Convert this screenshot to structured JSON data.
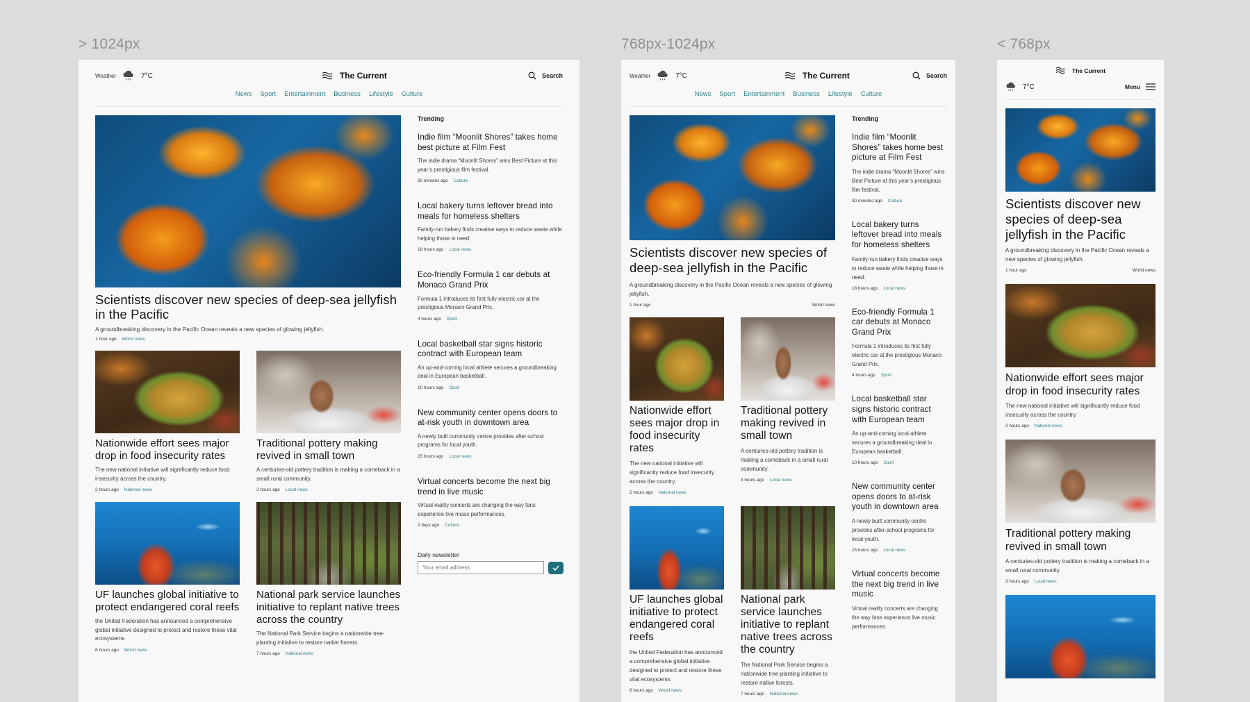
{
  "breakpoints": {
    "desktop": "> 1024px",
    "tablet": "768px-1024px",
    "mobile": "< 768px"
  },
  "header": {
    "weather_label": "Weather",
    "weather_icon": "rain-cloud-icon",
    "temperature": "7°C",
    "brand_icon": "waves-icon",
    "brand_name": "The Current",
    "search_label": "Search",
    "search_icon": "search-icon",
    "menu_label": "Menu",
    "menu_icon": "hamburger-icon"
  },
  "nav": [
    "News",
    "Sport",
    "Entertainment",
    "Business",
    "Lifestyle",
    "Culture"
  ],
  "hero": {
    "title": "Scientists discover new species of deep-sea jellyfish in the Pacific",
    "summary": "A groundbreaking discovery in the Pacific Ocean reveals a new species of glowing jellyfish.",
    "time": "1 hour ago",
    "category": "World news",
    "image": "jellyfish-photo"
  },
  "cards": [
    {
      "title": "Nationwide effort sees major drop in food insecurity rates",
      "summary": "The new national initiative will significantly reduce food insecurity across the country.",
      "time": "2 hours ago",
      "category": "National news",
      "image": "pasta-photo"
    },
    {
      "title": "Traditional pottery making revived in small town",
      "summary": "A centuries-old pottery tradition is making a comeback in a small rural community.",
      "time": "3 hours ago",
      "category": "Local news",
      "image": "pottery-photo"
    },
    {
      "title": "UF launches global initiative to protect endangered coral reefs",
      "summary": "the United Federation has announced a comprehensive global initiative designed to protect and restore these vital ecosystems",
      "time": "6 hours ago",
      "category": "World news",
      "image": "coral-reef-photo"
    },
    {
      "title": "National park service launches initiative to replant native trees across the country",
      "summary": "The National Park Service begins a nationwide tree-planting initiative to restore native forests.",
      "time": "7 hours ago",
      "category": "National news",
      "image": "forest-photo"
    }
  ],
  "trending": {
    "title": "Trending",
    "items": [
      {
        "title": "Indie film “Moonlit Shores” takes home best picture at Film Fest",
        "summary": "The indie drama “Moonlit Shores” wins Best Picture at this year’s prestigious film festival.",
        "time": "30 minutes ago",
        "category": "Culture"
      },
      {
        "title": "Local bakery turns leftover bread into meals for homeless shelters",
        "summary": "Family-run bakery finds creative ways to reduce waste while helping those in need.",
        "time": "18 hours ago",
        "category": "Local news"
      },
      {
        "title": "Eco-friendly Formula 1 car debuts at Monaco Grand Prix",
        "summary": "Formula 1 introduces its first fully electric car at the prestigious Monaco Grand Prix.",
        "time": "4 hours ago",
        "category": "Sport"
      },
      {
        "title": "Local basketball star signs historic contract with European team",
        "summary": "An up-and-coming local athlete secures a groundbreaking deal in European basketball.",
        "time": "10 hours ago",
        "category": "Sport"
      },
      {
        "title": "New community center opens doors to at-risk youth in downtown area",
        "summary": "A newly built community centre provides after-school programs for local youth.",
        "time": "15 hours ago",
        "category": "Local news"
      },
      {
        "title": "Virtual concerts become the next big trend in live music",
        "summary": "Virtual reality concerts are changing the way fans experience live music performances.",
        "time": "2 days ago",
        "category": "Culture"
      }
    ]
  },
  "newsletter": {
    "label": "Daily newsletter",
    "placeholder": "Your email address",
    "submit_icon": "check-icon"
  },
  "colors": {
    "accent": "#2f7f86",
    "button": "#1f6e7c",
    "backdrop": "#dcdcdc",
    "page": "#f8f8f8"
  }
}
